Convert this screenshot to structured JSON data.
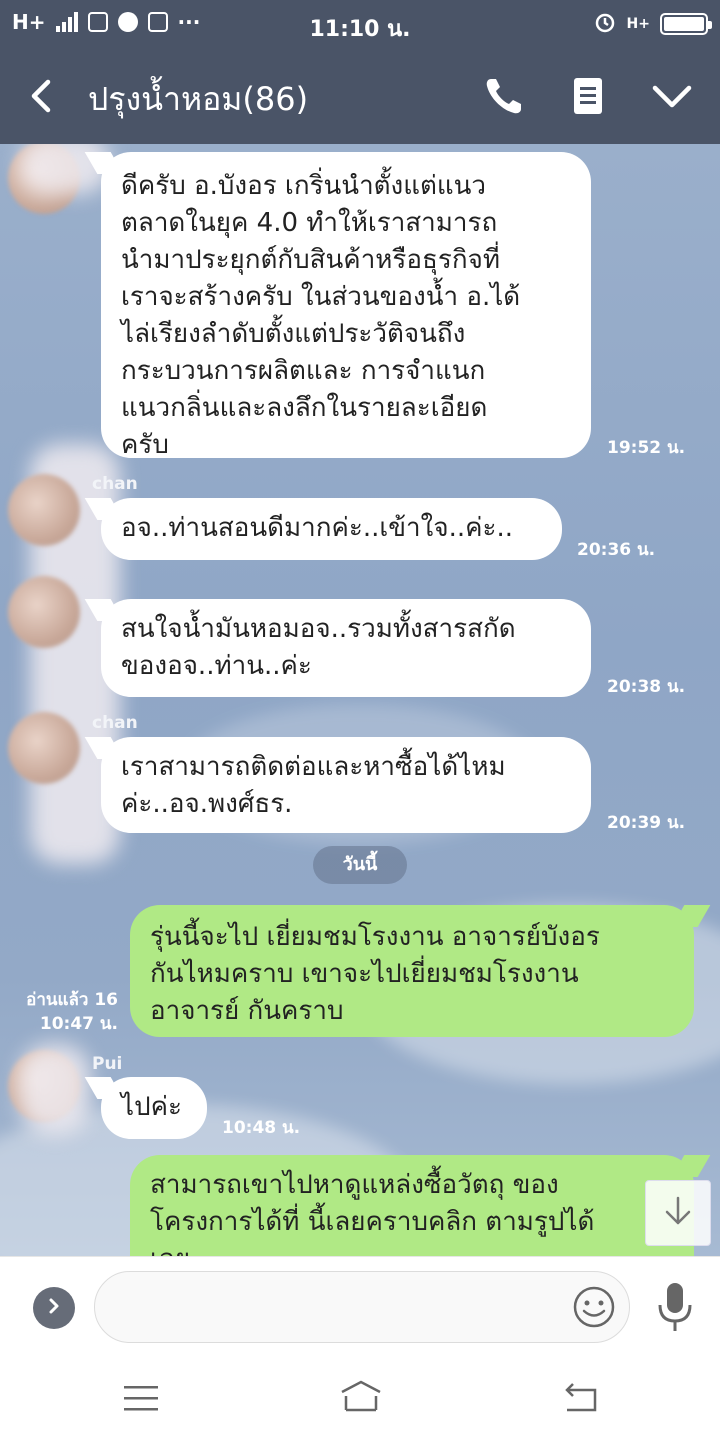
{
  "status_bar": {
    "network": "H+",
    "time": "11:10 น.",
    "network_right": "H+"
  },
  "header": {
    "title": "ปรุงน้ำหอม(86)"
  },
  "messages": [
    {
      "lines": [
        "ดีครับ อ.บังอร เกริ่นนำตั้งแต่แนว",
        "ตลาดในยุค 4.0 ทำให้เราสามารถ",
        "นำมาประยุกต์กับสินค้าหรือธุรกิจที่",
        "เราจะสร้างครับ ในส่วนของน้ำ อ.ได้",
        "ไล่เรียงลำดับตั้งแต่ประวัติจนถึง",
        "กระบวนการผลิตและ การจำแนก",
        "แนวกลิ่นและลงลึกในรายละเอียด",
        "ครับ"
      ],
      "time": "19:52 น."
    },
    {
      "sender": "chan",
      "lines": [
        "อจ..ท่านสอนดีมากค่ะ..เข้าใจ..ค่ะ.."
      ],
      "time": "20:36 น."
    },
    {
      "lines": [
        "สนใจน้ำมันหอมอจ..รวมทั้งสารสกัด",
        "ของอจ..ท่าน..ค่ะ"
      ],
      "time": "20:38 น."
    },
    {
      "sender": "chan",
      "lines": [
        "เราสามารถติดต่อและหาซื้อได้ไหม",
        "ค่ะ..อจ.พงศ์ธร."
      ],
      "time": "20:39 น."
    },
    {
      "lines": [
        " รุ่นนี้จะไป เยี่ยมชมโรงงาน อาจารย์บังอร",
        "กันไหมคราบ  เขาจะไปเยี่ยมชมโรงงาน",
        "อาจารย์ กันคราบ"
      ],
      "read_label": "อ่านแล้ว 16",
      "time": "10:47 น."
    },
    {
      "sender": "Pui",
      "lines": [
        "ไปค่ะ"
      ],
      "time": "10:48 น."
    },
    {
      "lines": [
        "สามารถเขาไปหาดูแหล่งซื้อวัตถุ ของ",
        "โครงการได้ที่ นี้เลยคราบคลิก ตามรูปได้",
        "เลย"
      ]
    }
  ],
  "date_divider": "วันนี้",
  "input": {
    "placeholder": ""
  },
  "icons": {
    "back": "back-arrow-icon",
    "call": "phone-icon",
    "notes": "note-icon",
    "menu": "chevron-down-icon",
    "scroll": "arrow-down-icon",
    "expand": "chevron-right-icon",
    "emoji": "smiley-icon",
    "mic": "microphone-icon"
  },
  "colors": {
    "header_bg": "#4a5467",
    "incoming_bubble": "#ffffff",
    "outgoing_bubble": "#b0e985",
    "chat_bg": "#93a9c7"
  }
}
